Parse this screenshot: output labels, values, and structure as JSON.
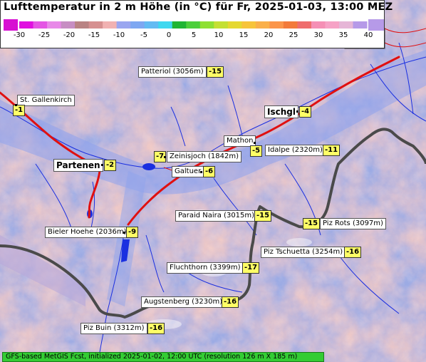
{
  "header": {
    "title": "Lufttemperatur in 2 m Höhe (in °C) für Fr, 2025-01-03, 13:00 MEZ"
  },
  "legend": {
    "ticks": [
      "-30",
      "-25",
      "-20",
      "-15",
      "-10",
      "-5",
      "0",
      "5",
      "10",
      "15",
      "20",
      "25",
      "30",
      "35",
      "40"
    ],
    "colors": [
      "#e010e0",
      "#e455e4",
      "#e889e8",
      "#c78ec3",
      "#b98383",
      "#d69090",
      "#f1b2b2",
      "#9aa6f0",
      "#7da7f2",
      "#63bbf3",
      "#3fd8f0",
      "#1fb533",
      "#4ccf3b",
      "#8ee033",
      "#c4e033",
      "#e5d831",
      "#f7c43a",
      "#fab04a",
      "#fb954a",
      "#f37a3a",
      "#ef6d6d",
      "#f58fb5",
      "#f6a2c6",
      "#e6b6d7",
      "#b69ae8"
    ],
    "low_color": "#d70fd2",
    "high_color": "#b69ae8"
  },
  "stations": [
    {
      "name": "Patteriol (3056m)",
      "value": "-15"
    },
    {
      "name": "St. Gallenkirch",
      "value": "-1"
    },
    {
      "name": "Ischgl",
      "value": "-4"
    },
    {
      "name": "Mathon",
      "value": "-5"
    },
    {
      "name": "Idalpe (2320m)",
      "value": "-11"
    },
    {
      "name": "Zeinisjoch (1842m)",
      "value": "-7"
    },
    {
      "name": "Partenen",
      "value": "-2"
    },
    {
      "name": "Galtuer",
      "value": "-6"
    },
    {
      "name": "Paraid Naira (3015m)",
      "value": "-15"
    },
    {
      "name": "Piz Rots (3097m)",
      "value": "-15"
    },
    {
      "name": "Bieler Hoehe (2036m)",
      "value": "-9"
    },
    {
      "name": "Piz Tschuetta (3254m)",
      "value": "-16"
    },
    {
      "name": "Fluchthorn (3399m)",
      "value": "-17"
    },
    {
      "name": "Augstenberg (3230m)",
      "value": "-16"
    },
    {
      "name": "Piz Buin (3312m)",
      "value": "-16"
    }
  ],
  "footer": {
    "text": "GFS-based MetGIS Fcst, initialized 2025-01-02, 12:00 UTC  (resolution 126 m X 185 m)"
  },
  "colors": {
    "terrain_warm": "#d89a8f",
    "terrain_cool": "#98a9e6",
    "rivers": "#1a2fe0",
    "roads": "#e01010",
    "border": "#4a4a4a"
  }
}
